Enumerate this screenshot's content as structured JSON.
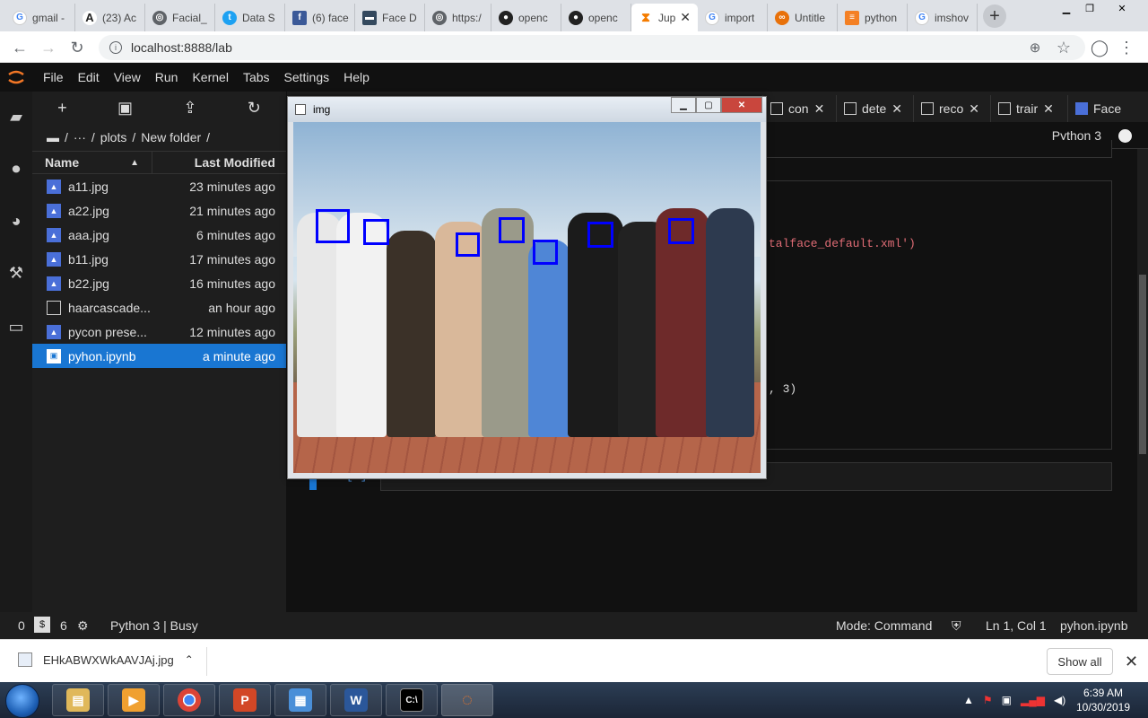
{
  "browser": {
    "tabs": [
      {
        "title": "gmail -",
        "icon": "google-icon",
        "color": "#4285f4"
      },
      {
        "title": "(23) Ac",
        "icon": "academia-icon",
        "color": "#222222"
      },
      {
        "title": "Facial_",
        "icon": "globe-icon",
        "color": "#5f6368"
      },
      {
        "title": "Data S",
        "icon": "twitter-icon",
        "color": "#1da1f2"
      },
      {
        "title": "(6) face",
        "icon": "facebook-icon",
        "color": "#3b5998"
      },
      {
        "title": "Face D",
        "icon": "site-icon",
        "color": "#34495e"
      },
      {
        "title": "https:/",
        "icon": "globe-icon",
        "color": "#5f6368"
      },
      {
        "title": "openc",
        "icon": "github-icon",
        "color": "#222222"
      },
      {
        "title": "openc",
        "icon": "github-icon",
        "color": "#222222"
      },
      {
        "title": "Jup",
        "icon": "hourglass-icon",
        "color": "#f57c00"
      },
      {
        "title": "import",
        "icon": "google-icon",
        "color": "#4285f4"
      },
      {
        "title": "Untitle",
        "icon": "colab-icon",
        "color": "#e8710a"
      },
      {
        "title": "python",
        "icon": "stackoverflow-icon",
        "color": "#f48024"
      },
      {
        "title": "imshov",
        "icon": "google-icon",
        "color": "#4285f4"
      }
    ],
    "url": "localhost:8888/lab"
  },
  "jupyter": {
    "menu": [
      "File",
      "Edit",
      "View",
      "Run",
      "Kernel",
      "Tabs",
      "Settings",
      "Help"
    ],
    "breadcrumb": [
      "/",
      "···",
      "/",
      "plots",
      "/",
      "New folder",
      "/"
    ],
    "file_header": {
      "name": "Name",
      "modified": "Last Modified"
    },
    "files": [
      {
        "name": "a11.jpg",
        "modified": "23 minutes ago",
        "type": "image"
      },
      {
        "name": "a22.jpg",
        "modified": "21 minutes ago",
        "type": "image"
      },
      {
        "name": "aaa.jpg",
        "modified": "6 minutes ago",
        "type": "image"
      },
      {
        "name": "b11.jpg",
        "modified": "17 minutes ago",
        "type": "image"
      },
      {
        "name": "b22.jpg",
        "modified": "16 minutes ago",
        "type": "image"
      },
      {
        "name": "haarcascade...",
        "modified": "an hour ago",
        "type": "file"
      },
      {
        "name": "pycon prese...",
        "modified": "12 minutes ago",
        "type": "image"
      },
      {
        "name": "pyhon.ipynb",
        "modified": "a minute ago",
        "type": "notebook"
      }
    ],
    "doc_tabs": [
      "con",
      "dete",
      "reco",
      "trair",
      "Face"
    ],
    "kernel": "Python 3",
    "code_fragments": {
      "line1": "talface_default.xml')",
      "line2": ", 3)"
    },
    "prompt": "[ ]:",
    "status": {
      "left_num1": "0",
      "left_num2": "6",
      "kernel_state": "Python 3 | Busy",
      "mode": "Mode: Command",
      "position": "Ln 1, Col 1",
      "file": "pyhon.ipynb"
    }
  },
  "cv_window": {
    "title": "img"
  },
  "downloads": {
    "file": "EHkABWXWkAAVJAj.jpg",
    "show_all": "Show all"
  },
  "taskbar": {
    "time": "6:39 AM",
    "date": "10/30/2019"
  }
}
